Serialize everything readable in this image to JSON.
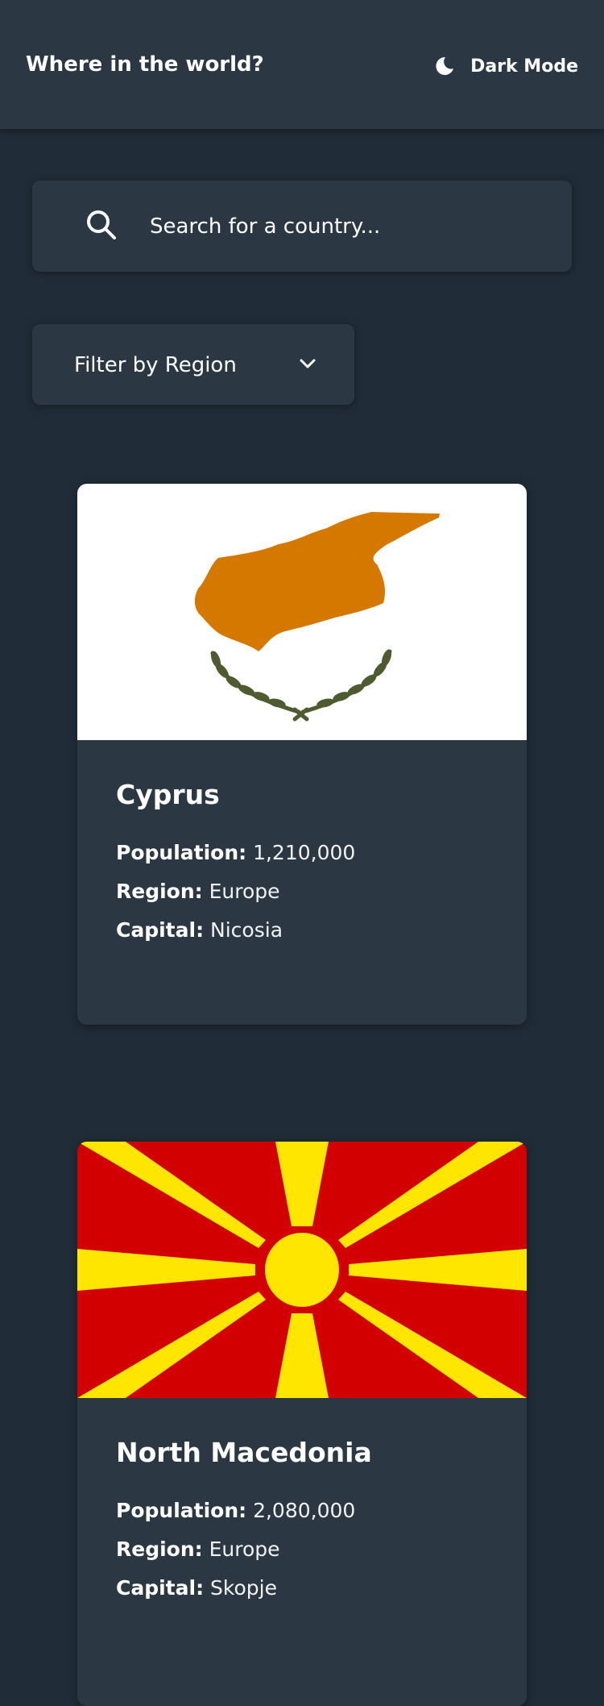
{
  "header": {
    "title": "Where in the world?",
    "mode_icon": "moon-icon",
    "mode_label": "Dark Mode"
  },
  "search": {
    "icon": "search-icon",
    "placeholder": "Search for a country..."
  },
  "filter": {
    "label": "Filter by Region",
    "icon": "chevron-down-icon"
  },
  "countries": [
    {
      "name": "Cyprus",
      "population_label": "Population:",
      "population": "1,210,000",
      "region_label": "Region:",
      "region": "Europe",
      "capital_label": "Capital:",
      "capital": "Nicosia",
      "flag_colors": {
        "background": "#ffffff",
        "island": "#d57800",
        "branches": "#4e5b31"
      }
    },
    {
      "name": "North Macedonia",
      "population_label": "Population:",
      "population": "2,080,000",
      "region_label": "Region:",
      "region": "Europe",
      "capital_label": "Capital:",
      "capital": "Skopje",
      "flag_colors": {
        "background": "#d20000",
        "sun": "#ffe600"
      }
    }
  ],
  "colors": {
    "page_background": "#202c37",
    "element_background": "#2b3844",
    "text": "#ffffff"
  }
}
